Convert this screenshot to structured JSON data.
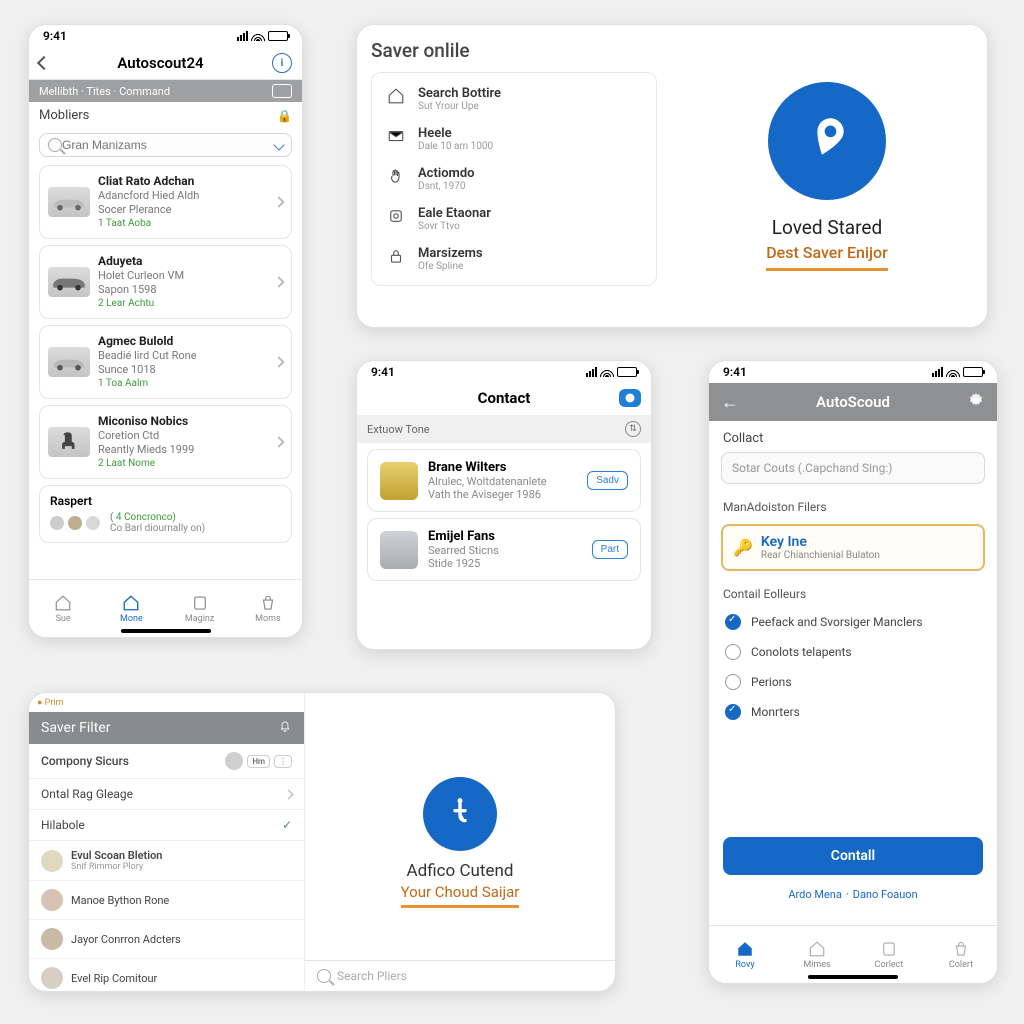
{
  "frameA": {
    "time": "9:41",
    "title": "Autoscout24",
    "info_icon": "i",
    "toolbar": "Mellibth · Tites · Command",
    "section": "Mobliers",
    "search_placeholder": "Gran Manizams",
    "items": [
      {
        "title": "Cliat Rato Adchan",
        "sub1": "Adancford Hied Aldh",
        "sub2": "Socer Plerance",
        "meta": "1 Taat Aoba"
      },
      {
        "title": "Aduyeta",
        "sub1": "Holet Curleon VM",
        "sub2": "Sapon 1598",
        "meta": "2 Lear Achtu"
      },
      {
        "title": "Agmec Bulold",
        "sub1": "Beadié lird Cut Rone",
        "sub2": "Sunce 1018",
        "meta": "1 Toa Aalm"
      },
      {
        "title": "Miconiso Nobics",
        "sub1": "Coretion Ctd",
        "sub2": "Reantly Mieds 1999",
        "meta": "2 Laat Nome"
      }
    ],
    "raspert": {
      "title": "Raspert",
      "sub": "( 4 Concronco)",
      "sub2": "Co Barl diournally on)"
    },
    "tabs": [
      "Sue",
      "Mone",
      "Maginz",
      "Moms"
    ]
  },
  "frameB": {
    "heading": "Saver onlile",
    "items": [
      {
        "t": "Search Bottire",
        "s": "Sut Yrour Upe"
      },
      {
        "t": "Heele",
        "s": "Dale 10 am 1000"
      },
      {
        "t": "Actiomdo",
        "s": "Dsnt, 1970"
      },
      {
        "t": "Eale Etaonar",
        "s": "Sovr Ttvo"
      },
      {
        "t": "Marsizems",
        "s": "Ofe Spline"
      }
    ],
    "loved": "Loved Stared",
    "dest": "Dest Saver Enijor"
  },
  "frameC": {
    "time": "9:41",
    "title": "Contact",
    "section": "Extuow Tone",
    "rows": [
      {
        "t": "Brane Wilters",
        "s1": "Alrulec, Woltdatenanlete",
        "s2": "Vath the Aviseger 1986",
        "btn": "Sadv"
      },
      {
        "t": "Emijel Fans",
        "s1": "Searred Sticns",
        "s2": "Stide 1925",
        "btn": "Part"
      }
    ]
  },
  "frameD": {
    "time": "9:41",
    "title": "AutoScoud",
    "label": "Collact",
    "placeholder": "Sotar Couts (.Capchand Sing:)",
    "group1": "ManAdoiston Filers",
    "key_t": "Key Ine",
    "key_s": "Rear Chianchienial Bulaton",
    "group2": "Contail Eolleurs",
    "options": [
      {
        "label": "Peefack and Svorsiger Manclers",
        "on": true
      },
      {
        "label": "Conolots telapents",
        "on": false
      },
      {
        "label": "Perions",
        "on": false
      },
      {
        "label": "Monrters",
        "on": true
      }
    ],
    "cta": "Contall",
    "link1": "Ardo Mena",
    "link2": "Dano Foauon",
    "tabs": [
      "Rovy",
      "Mimes",
      "Corlect",
      "Colert"
    ]
  },
  "frameE": {
    "tag": "Prim",
    "bar": "Saver Filter",
    "rows": [
      {
        "t": "Compony Sicurs",
        "type": "avatar-pill",
        "pill": "Hm"
      },
      {
        "t": "Ontal Rag Gleage",
        "type": "chev"
      },
      {
        "t": "Hilabole",
        "type": "green"
      }
    ],
    "people": [
      {
        "t": "Evul Scoan Bletion",
        "s": "Snif Rimmor Plory"
      },
      {
        "t": "Manoe Bython Rone",
        "s": ""
      },
      {
        "t": "Jayor Conrron Adcters",
        "s": ""
      },
      {
        "t": "Evel Rip Comitour",
        "s": ""
      }
    ],
    "brand_t": "Adfico Cutend",
    "brand_s": "Your Choud Saijar",
    "search": "Search Pliers"
  }
}
